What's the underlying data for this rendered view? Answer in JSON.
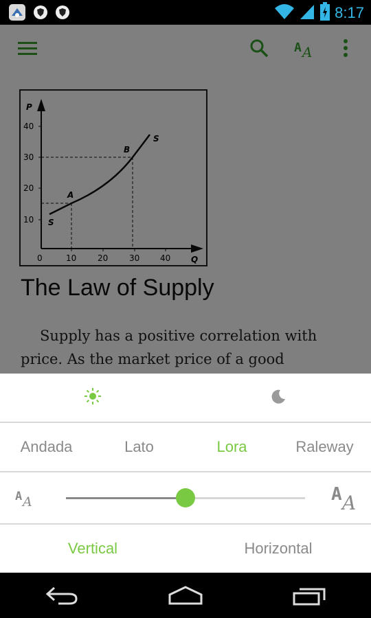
{
  "status_bar": {
    "time": "8:17",
    "icons": [
      "app-icon",
      "shield-icon",
      "shield-icon",
      "wifi-icon",
      "signal-icon",
      "battery-charging-icon"
    ]
  },
  "toolbar": {
    "icons": [
      "menu-icon",
      "search-icon",
      "font-settings-icon",
      "overflow-menu-icon"
    ]
  },
  "article": {
    "figure_text": {
      "y_axis": "P",
      "x_axis": "Q",
      "y_ticks": [
        "40",
        "30",
        "20",
        "10"
      ],
      "x_ticks": [
        "0",
        "10",
        "20",
        "30",
        "40"
      ],
      "point_a": "A",
      "point_b": "B",
      "curve_start": "S",
      "curve_end": "S"
    },
    "title": "The Law of Supply",
    "paragraph": "Supply has a positive correlation with price. As the market price of a good"
  },
  "settings_panel": {
    "themes": [
      "sun-icon",
      "moon-icon"
    ],
    "selected_theme": "sun-icon",
    "fonts": [
      "Andada",
      "Lato",
      "Lora",
      "Raleway"
    ],
    "selected_font": "Lora",
    "text_size_level": 0.5,
    "layouts": [
      "Vertical",
      "Horizontal"
    ],
    "selected_layout": "Vertical",
    "accent_color": "#7ac943"
  },
  "nav_bar": {
    "icons": [
      "back-icon",
      "home-icon",
      "recent-apps-icon"
    ]
  }
}
